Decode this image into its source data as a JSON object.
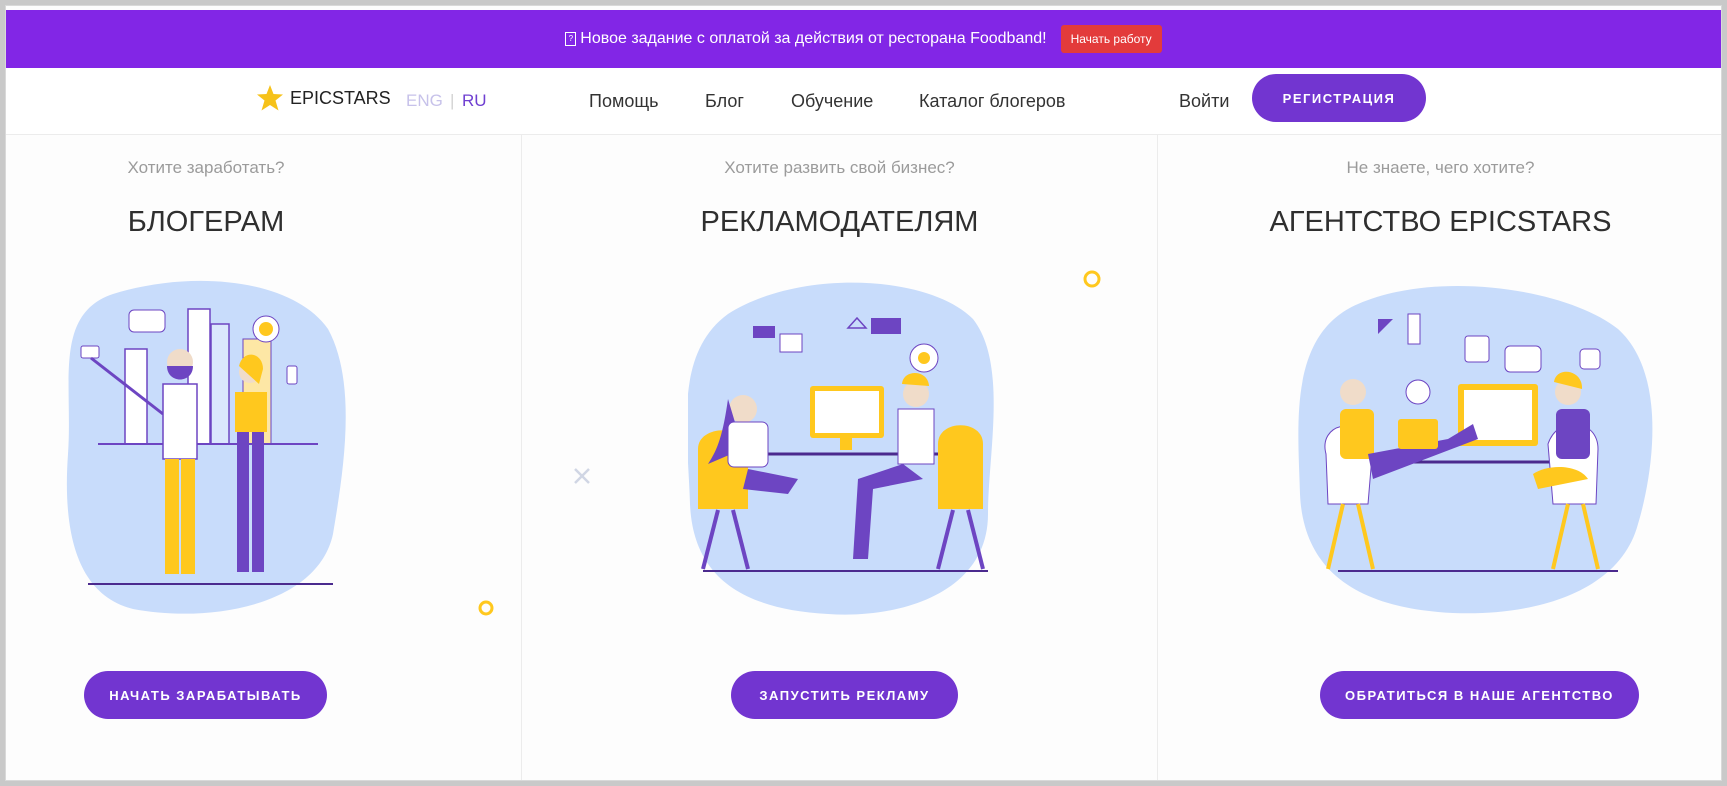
{
  "promo": {
    "icon": "gift-icon",
    "text": "Новое задание с оплатой за действия от ресторана Foodband!",
    "button": "Начать работу"
  },
  "header": {
    "logo": "EPICSTARS",
    "lang_eng": "ENG",
    "lang_sep": "|",
    "lang_ru": "RU",
    "nav": [
      "Помощь",
      "Блог",
      "Обучение",
      "Каталог блогеров"
    ],
    "login": "Войти",
    "register": "РЕГИСТРАЦИЯ"
  },
  "columns": [
    {
      "subtitle": "Хотите заработать?",
      "title": "БЛОГЕРАМ",
      "button": "НАЧАТЬ ЗАРАБАТЫВАТЬ",
      "illustration": "bloggers-illustration"
    },
    {
      "subtitle": "Хотите развить свой бизнес?",
      "title": "РЕКЛАМОДАТЕЛЯМ",
      "button": "ЗАПУСТИТЬ РЕКЛАМУ",
      "illustration": "advertisers-illustration"
    },
    {
      "subtitle": "Не знаете, чего хотите?",
      "title": "АГЕНТСТВО EPICSTARS",
      "button": "ОБРАТИТЬСЯ В НАШЕ АГЕНТСТВО",
      "illustration": "agency-illustration"
    }
  ],
  "colors": {
    "promo": "#8226e6",
    "accent": "#7235d0",
    "promo_button": "#e33b3b",
    "illustration_bg": "#c8dcfb",
    "yellow": "#ffc81e"
  }
}
